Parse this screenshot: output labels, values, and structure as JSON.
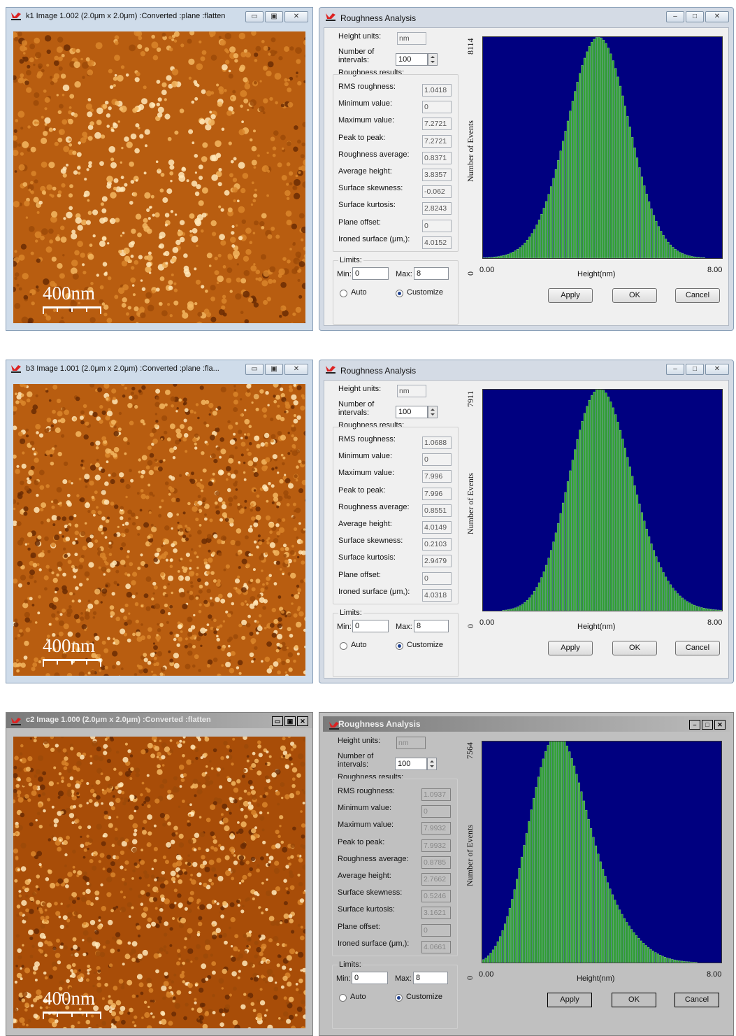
{
  "labels": {
    "height_units": "Height units:",
    "number_of_intervals": "Number of intervals:",
    "roughness_results": "Roughness results:",
    "rms": "RMS roughness:",
    "min": "Minimum value:",
    "max": "Maximum value:",
    "peak": "Peak  to peak:",
    "ravg": "Roughness average:",
    "havg": "Average height:",
    "skew": "Surface skewness:",
    "kurt": "Surface kurtosis:",
    "plane": "Plane offset:",
    "ironed": "Ironed surface (μm,):",
    "limits": "Limits:",
    "min_limit": "Min:",
    "max_limit": "Max:",
    "auto": "Auto",
    "customize": "Customize",
    "apply": "Apply",
    "ok": "OK",
    "cancel": "Cancel",
    "y_axis": "Number of Events",
    "x_axis": "Height(nm)",
    "scale_bar": "400nm",
    "dialog_title": "Roughness Analysis"
  },
  "colors": {
    "plot_bg": "#000080",
    "bar": "#2ea02e",
    "bar_edge": "#9be09b"
  },
  "panels": [
    {
      "image_title": "k1 Image 1.002 (2.0μm x 2.0μm) :Converted :plane :flatten",
      "height_units": "nm",
      "intervals": "100",
      "results": {
        "rms": "1.0418",
        "min": "0",
        "max": "7.2721",
        "peak": "7.2721",
        "ravg": "0.8371",
        "havg": "3.8357",
        "skew": "-0.062",
        "kurt": "2.8243",
        "plane": "0",
        "ironed": "4.0152"
      },
      "limit_min": "0",
      "limit_max": "8",
      "chart_data": {
        "type": "bar",
        "title": "",
        "xlabel": "Height(nm)",
        "ylabel": "Number of Events",
        "xlim": [
          0.0,
          8.0
        ],
        "ylim": [
          0,
          8114
        ],
        "x_ticks": [
          "0.00",
          "8.00"
        ],
        "y_ticks": [
          "0",
          "8114"
        ],
        "mean": 3.8357,
        "sigma": 1.0418,
        "skew": -0.062,
        "bins": 100,
        "peak_count": 8114
      }
    },
    {
      "image_title": "b3 Image 1.001 (2.0μm x 2.0μm) :Converted :plane :fla...",
      "height_units": "nm",
      "intervals": "100",
      "results": {
        "rms": "1.0688",
        "min": "0",
        "max": "7.996",
        "peak": "7.996",
        "ravg": "0.8551",
        "havg": "4.0149",
        "skew": "0.2103",
        "kurt": "2.9479",
        "plane": "0",
        "ironed": "4.0318"
      },
      "limit_min": "0",
      "limit_max": "8",
      "chart_data": {
        "type": "bar",
        "title": "",
        "xlabel": "Height(nm)",
        "ylabel": "Number of Events",
        "xlim": [
          0.0,
          8.0
        ],
        "ylim": [
          0,
          7911
        ],
        "x_ticks": [
          "0.00",
          "8.00"
        ],
        "y_ticks": [
          "0",
          "7911"
        ],
        "mean": 4.0149,
        "sigma": 1.0688,
        "skew": 0.2103,
        "bins": 100,
        "peak_count": 7911
      }
    },
    {
      "image_title": "c2 Image 1.000 (2.0μm x 2.0μm) :Converted :flatten",
      "height_units": "nm",
      "intervals": "100",
      "results": {
        "rms": "1.0937",
        "min": "0",
        "max": "7.9932",
        "peak": "7.9932",
        "ravg": "0.8785",
        "havg": "2.7662",
        "skew": "0.5246",
        "kurt": "3.1621",
        "plane": "0",
        "ironed": "4.0661"
      },
      "limit_min": "0",
      "limit_max": "8",
      "chart_data": {
        "type": "bar",
        "title": "",
        "xlabel": "Height(nm)",
        "ylabel": "Number of Events",
        "xlim": [
          0.0,
          8.0
        ],
        "ylim": [
          0,
          7564
        ],
        "x_ticks": [
          "0.00",
          "8.00"
        ],
        "y_ticks": [
          "0",
          "7564"
        ],
        "mean": 2.7662,
        "sigma": 1.0937,
        "skew": 0.5246,
        "bins": 100,
        "peak_count": 7564
      }
    }
  ]
}
